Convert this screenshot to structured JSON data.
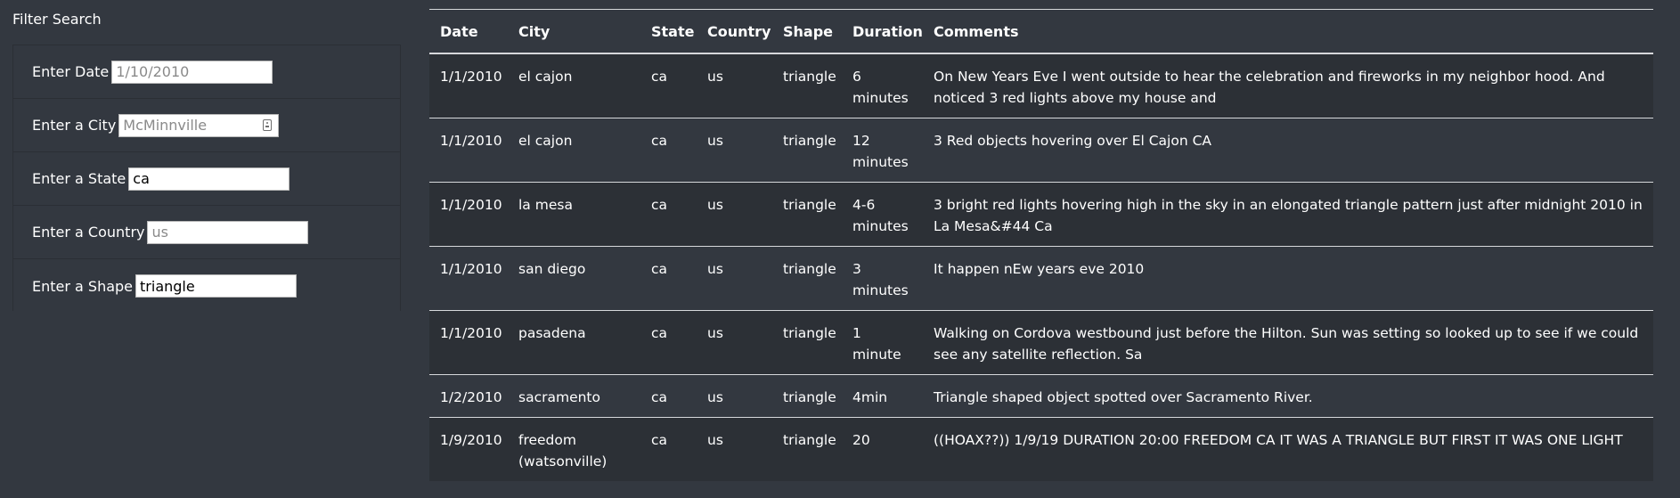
{
  "filter": {
    "title": "Filter Search",
    "fields": [
      {
        "label": "Enter Date",
        "value": "",
        "placeholder": "1/10/2010"
      },
      {
        "label": "Enter a City",
        "value": "",
        "placeholder": "McMinnville"
      },
      {
        "label": "Enter a State",
        "value": "ca",
        "placeholder": ""
      },
      {
        "label": "Enter a Country",
        "value": "",
        "placeholder": "us"
      },
      {
        "label": "Enter a Shape",
        "value": "triangle",
        "placeholder": ""
      }
    ]
  },
  "table": {
    "headers": [
      "Date",
      "City",
      "State",
      "Country",
      "Shape",
      "Duration",
      "Comments"
    ],
    "rows": [
      [
        "1/1/2010",
        "el cajon",
        "ca",
        "us",
        "triangle",
        "6 minutes",
        "On New Years Eve I went outside to hear the celebration and fireworks in my neighbor hood. And noticed 3 red lights above my house and"
      ],
      [
        "1/1/2010",
        "el cajon",
        "ca",
        "us",
        "triangle",
        "12 minutes",
        "3 Red objects hovering over El Cajon CA"
      ],
      [
        "1/1/2010",
        "la mesa",
        "ca",
        "us",
        "triangle",
        "4-6 minutes",
        "3 bright red lights hovering high in the sky in an elongated triangle pattern just after midnight 2010 in La Mesa&#44 Ca"
      ],
      [
        "1/1/2010",
        "san diego",
        "ca",
        "us",
        "triangle",
        "3 minutes",
        "It happen nEw years eve 2010"
      ],
      [
        "1/1/2010",
        "pasadena",
        "ca",
        "us",
        "triangle",
        "1 minute",
        "Walking on Cordova westbound just before the Hilton. Sun was setting so looked up to see if we could see any satellite reflection. Sa"
      ],
      [
        "1/2/2010",
        "sacramento",
        "ca",
        "us",
        "triangle",
        "4min",
        "Triangle shaped object spotted over Sacramento River."
      ],
      [
        "1/9/2010",
        "freedom (watsonville)",
        "ca",
        "us",
        "triangle",
        "20",
        "((HOAX??)) 1/9/19 DURATION 20:00 FREEDOM CA IT WAS A TRIANGLE BUT FIRST IT WAS ONE LIGHT"
      ]
    ]
  }
}
